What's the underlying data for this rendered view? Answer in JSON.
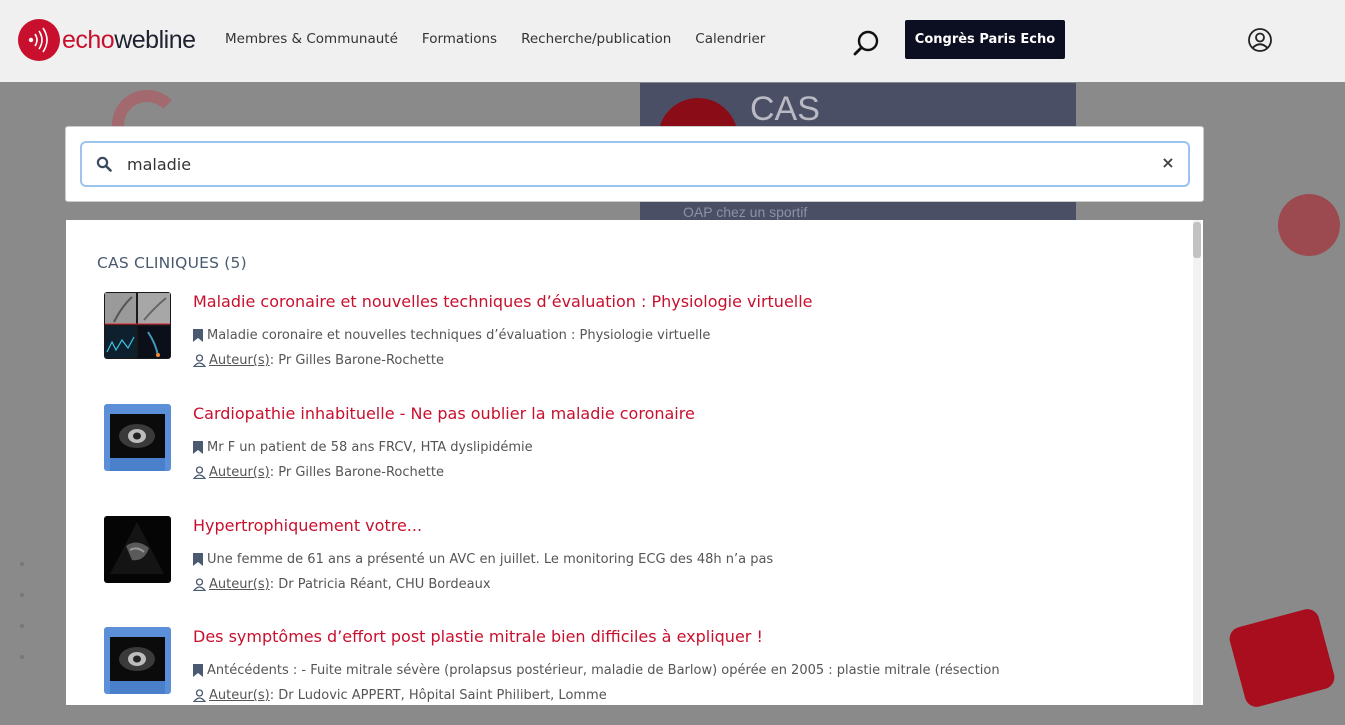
{
  "header": {
    "logo": {
      "echo": "echo",
      "webline": "webline"
    },
    "nav": [
      {
        "label": "Membres & Communauté"
      },
      {
        "label": "Formations"
      },
      {
        "label": "Recherche/publication"
      },
      {
        "label": "Calendrier"
      }
    ],
    "cta_label": "Congrès Paris Echo",
    "icons": {
      "search": "search-icon",
      "user": "user-icon"
    }
  },
  "background": {
    "card_title": "CAS",
    "card_subtitle": "OAP chez un sportif"
  },
  "search": {
    "value": "maladie",
    "clear_label": "×"
  },
  "results": {
    "section_title": "CAS CLINIQUES (5)",
    "items": [
      {
        "title": "Maladie coronaire et nouvelles techniques d’évaluation : Physiologie virtuelle",
        "description": "Maladie coronaire et nouvelles techniques d’évaluation : Physiologie virtuelle",
        "author_label": "Auteur(s)",
        "author": " : Pr Gilles Barone-Rochette"
      },
      {
        "title": "Cardiopathie inhabituelle - Ne pas oublier la maladie coronaire",
        "description": "Mr F un patient de 58 ans FRCV, HTA dyslipidémie",
        "author_label": "Auteur(s)",
        "author": " : Pr Gilles Barone-Rochette"
      },
      {
        "title": "Hypertrophiquement votre...",
        "description": "Une femme de 61 ans a présenté un AVC en juillet. Le monitoring ECG des 48h n’a pas",
        "author_label": "Auteur(s)",
        "author": " : Dr Patricia Réant, CHU Bordeaux"
      },
      {
        "title": "Des symptômes d’effort post plastie mitrale bien difficiles à expliquer !",
        "description": "Antécédents : - Fuite mitrale sévère (prolapsus postérieur, maladie de Barlow) opérée en 2005 : plastie mitrale (résection",
        "author_label": "Auteur(s)",
        "author": " : Dr Ludovic APPERT, Hôpital Saint Philibert, Lomme"
      }
    ]
  },
  "colors": {
    "brand_red": "#c8102e",
    "cta_bg": "#0c0e22",
    "focus_border": "#9ec3ef"
  }
}
